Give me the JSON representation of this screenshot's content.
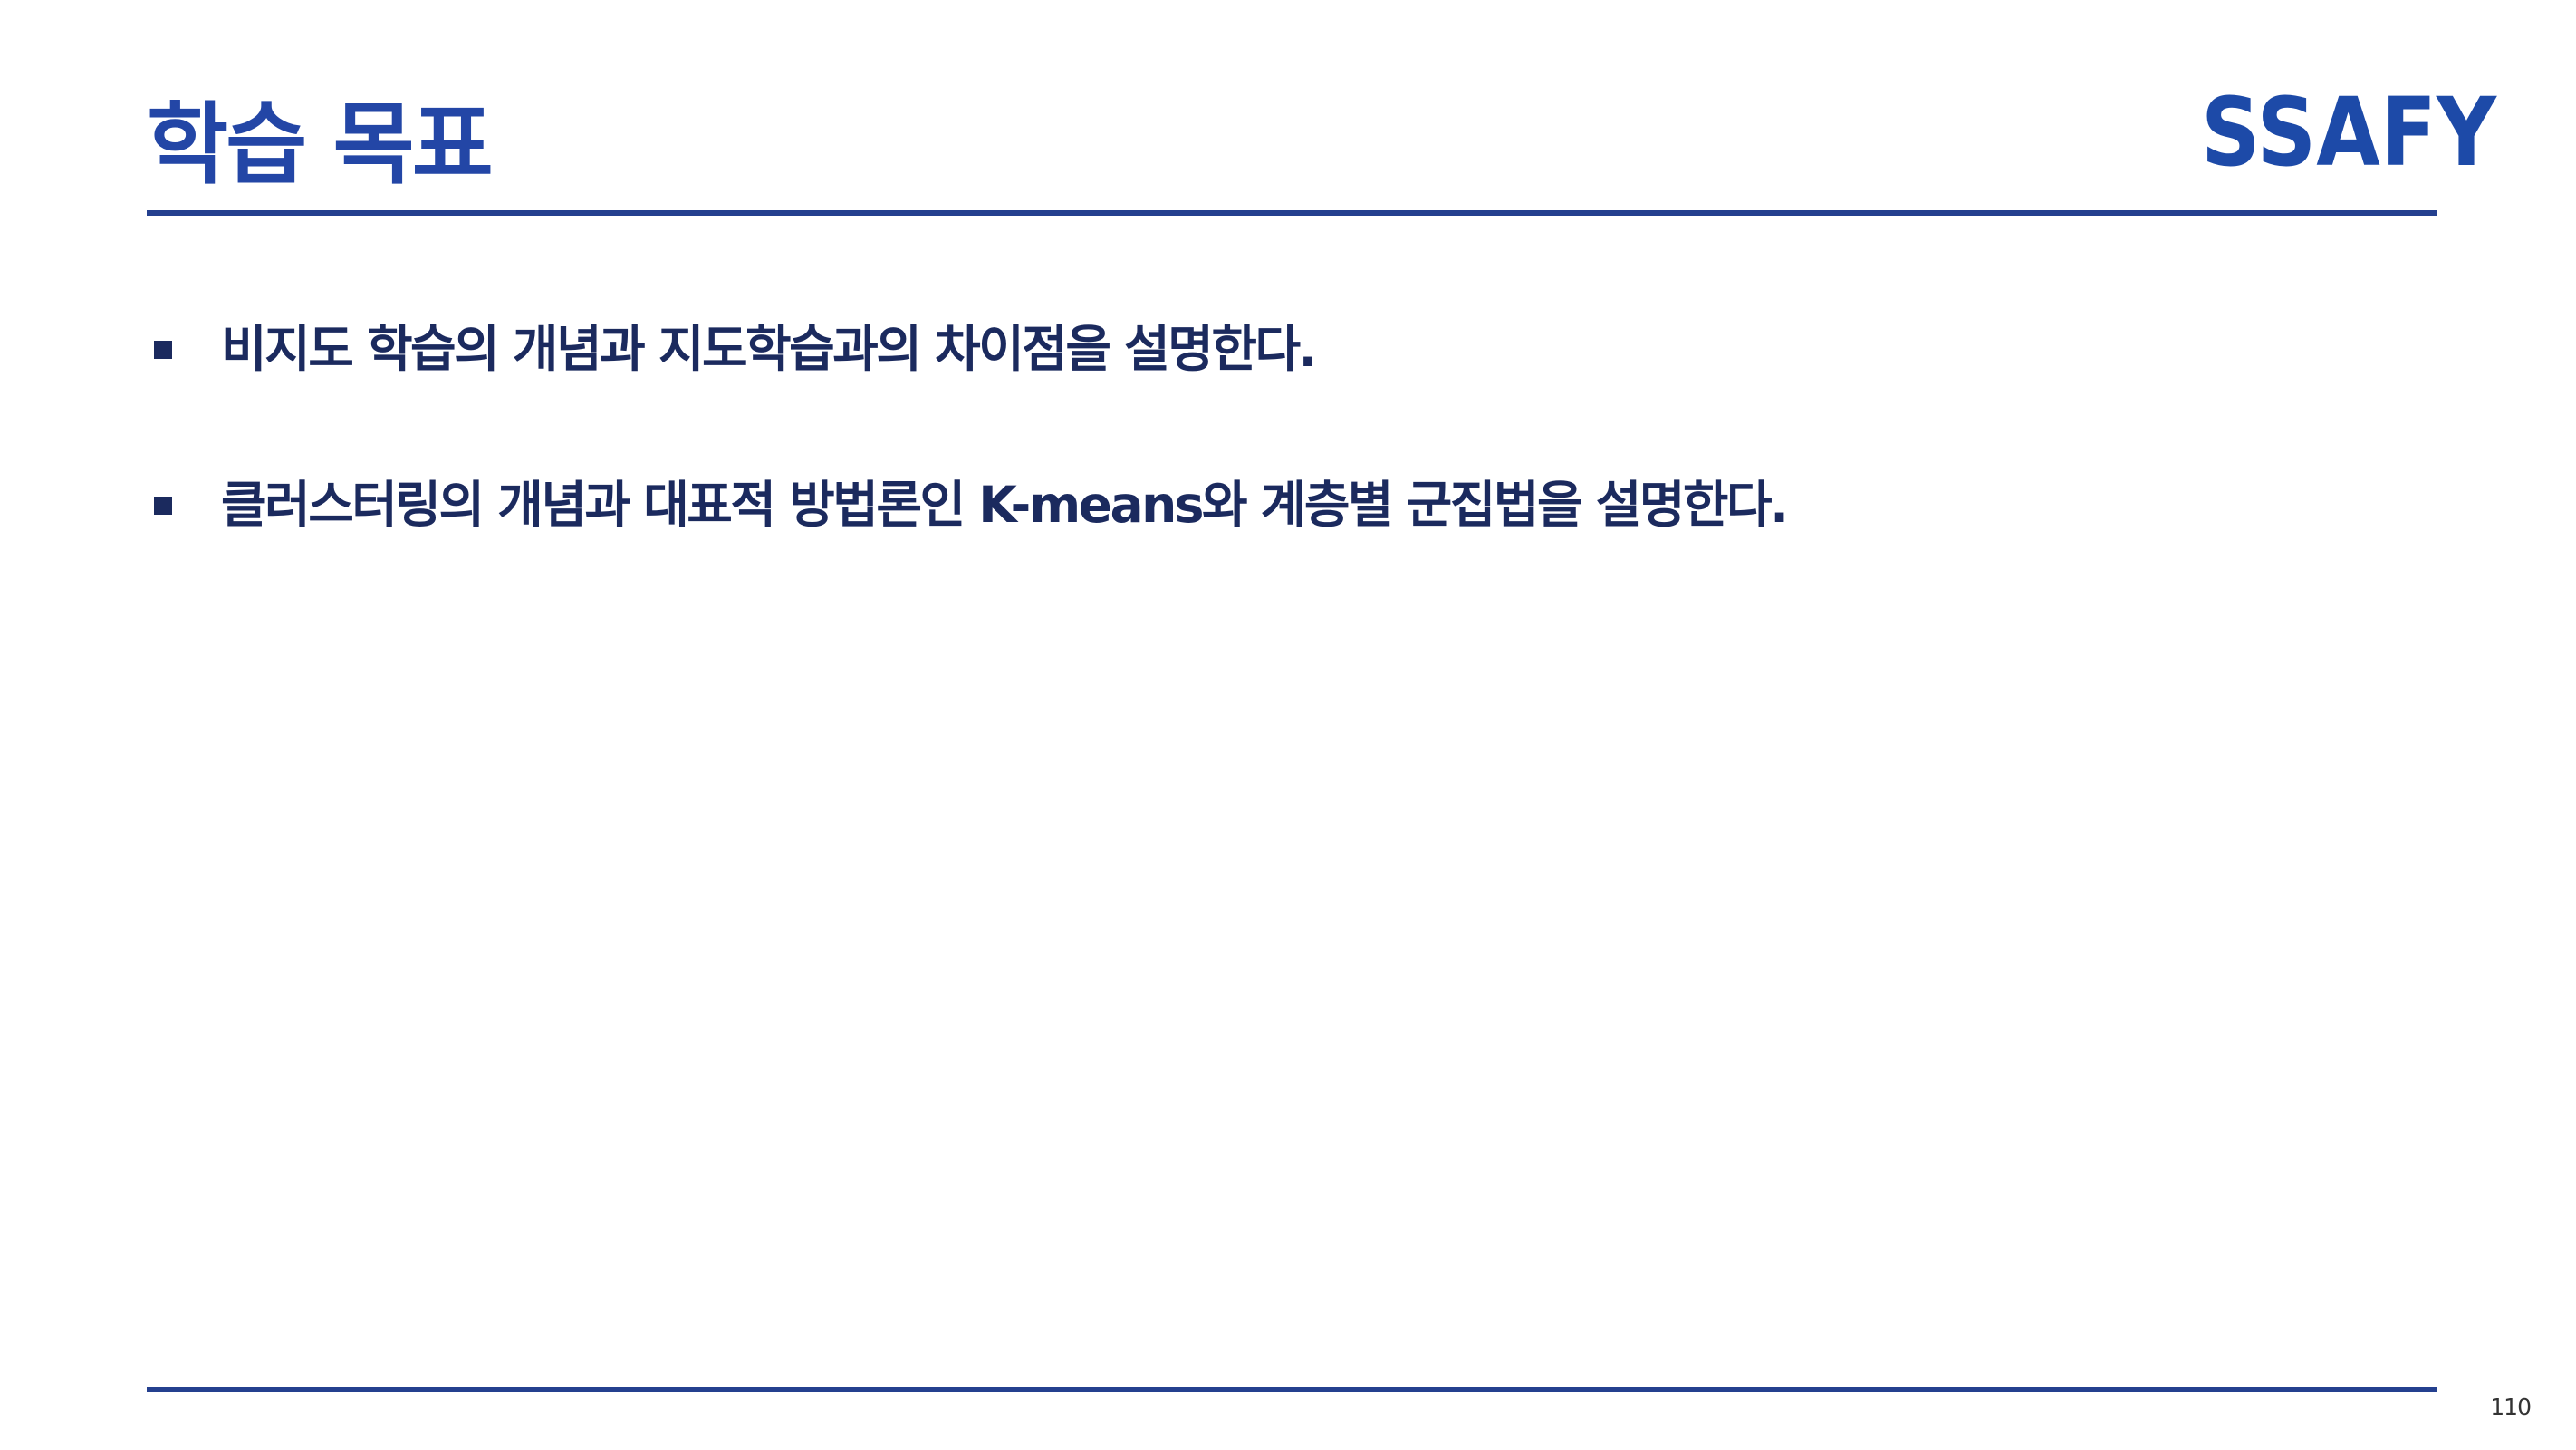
{
  "slide": {
    "title": "학습 목표",
    "page_number": "110"
  },
  "logo": {
    "text": "SSAFY",
    "colors": {
      "primary": "#1d4aa8",
      "highlight": "#ffffff"
    }
  },
  "objectives": [
    {
      "text": "비지도 학습의 개념과 지도학습과의 차이점을 설명한다."
    },
    {
      "text": "클러스터링의 개념과 대표적 방법론인 K-means와 계층별 군집법을 설명한다."
    }
  ],
  "colors": {
    "title": "#2346a6",
    "rule": "#24408f",
    "body_text": "#1b2a5e"
  }
}
